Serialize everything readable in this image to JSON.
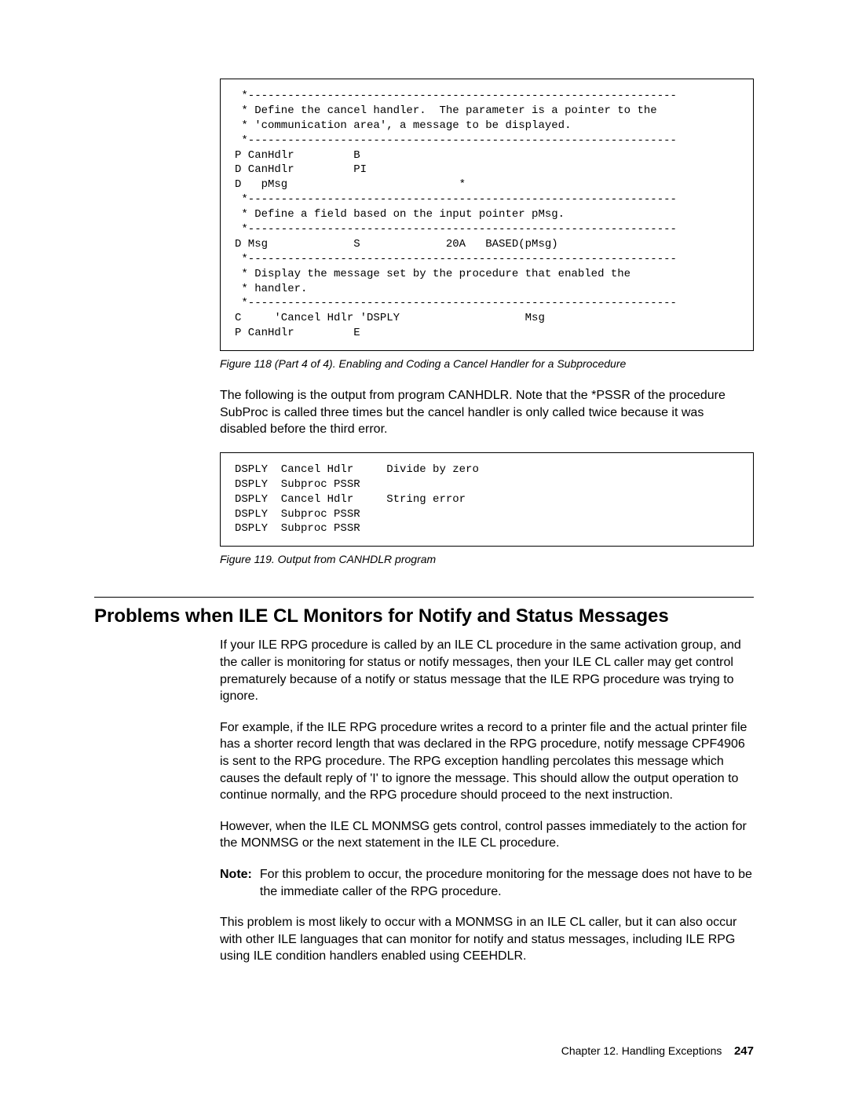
{
  "code1": " *-----------------------------------------------------------------\n * Define the cancel handler.  The parameter is a pointer to the\n * 'communication area', a message to be displayed.\n *-----------------------------------------------------------------\nP CanHdlr         B\nD CanHdlr         PI\nD   pMsg                          *\n *-----------------------------------------------------------------\n * Define a field based on the input pointer pMsg.\n *-----------------------------------------------------------------\nD Msg             S             20A   BASED(pMsg)\n *-----------------------------------------------------------------\n * Display the message set by the procedure that enabled the\n * handler.\n *-----------------------------------------------------------------\nC     'Cancel Hdlr 'DSPLY                   Msg\nP CanHdlr         E",
  "caption1": "Figure 118 (Part 4 of 4). Enabling and Coding a Cancel Handler for a Subprocedure",
  "para1": "The following is the output from program CANHDLR. Note that the *PSSR of the procedure SubProc is called three times but the cancel handler is only called twice because it was disabled before the third error.",
  "code2": "DSPLY  Cancel Hdlr     Divide by zero\nDSPLY  Subproc PSSR\nDSPLY  Cancel Hdlr     String error\nDSPLY  Subproc PSSR\nDSPLY  Subproc PSSR",
  "caption2": "Figure 119. Output from CANHDLR program",
  "heading": "Problems when ILE CL Monitors for Notify and Status Messages",
  "para2": "If your ILE RPG procedure is called by an ILE CL procedure in the same activation group, and the caller is monitoring for status or notify messages, then your ILE CL caller may get control prematurely because of a notify or status message that the ILE RPG procedure was trying to ignore.",
  "para3": "For example, if the ILE RPG procedure writes a record to a printer file and the actual printer file has a shorter record length that was declared in the RPG procedure, notify message CPF4906 is sent to the RPG procedure. The RPG exception handling percolates this message which causes the default reply of 'I' to ignore the message. This should allow the output operation to continue normally, and the RPG procedure should proceed to the next instruction.",
  "para4": "However, when the ILE CL MONMSG gets control, control passes immediately to the action for the MONMSG or the next statement in the ILE CL procedure.",
  "note_label": "Note:",
  "note_text": "For this problem to occur, the procedure monitoring for the message does not have to be the immediate caller of the RPG procedure.",
  "para5": "This problem is most likely to occur with a MONMSG in an ILE CL caller, but it can also occur with other ILE languages that can monitor for notify and status messages, including ILE RPG using ILE condition handlers enabled using CEEHDLR.",
  "footer_chapter": "Chapter 12. Handling Exceptions",
  "footer_page": "247"
}
